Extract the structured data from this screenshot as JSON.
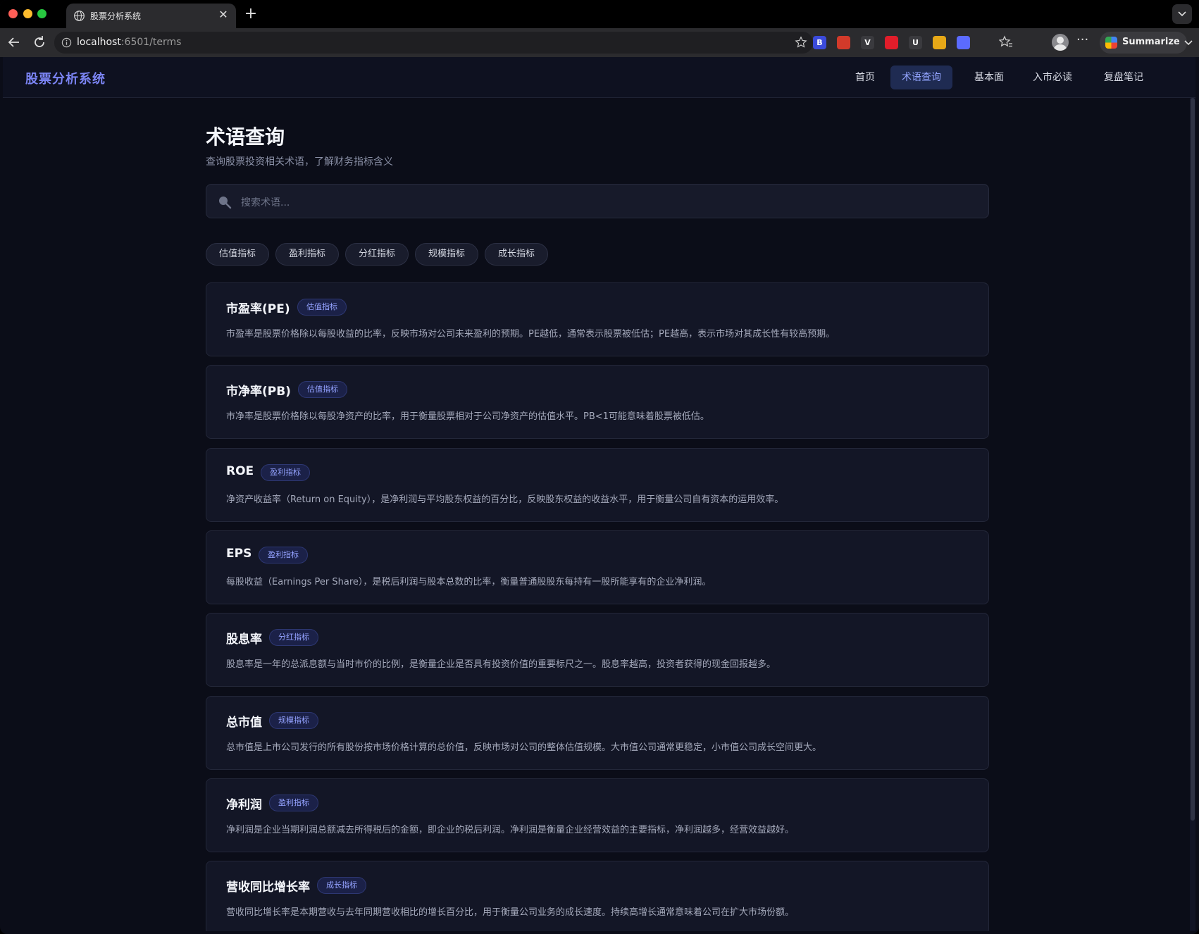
{
  "browser": {
    "tab_title": "股票分析系统",
    "url_host": "localhost",
    "url_path": ":6501/terms",
    "summarize_label": "Summarize",
    "extensions": [
      {
        "name": "b-extension-icon",
        "label": "B",
        "color": "#3b4bdb"
      },
      {
        "name": "red-extension-icon",
        "label": "",
        "color": "#d23a2a"
      },
      {
        "name": "v-extension-icon",
        "label": "V",
        "color": "#3a3a3e"
      },
      {
        "name": "shield-extension-icon",
        "label": "",
        "color": "#e11d2a"
      },
      {
        "name": "u-extension-icon",
        "label": "U",
        "color": "#3a3a3e"
      },
      {
        "name": "circle-extension-icon",
        "label": "",
        "color": "#e6a817"
      },
      {
        "name": "diamond-extension-icon",
        "label": "",
        "color": "#5b6bff"
      }
    ]
  },
  "app": {
    "brand": "股票分析系统",
    "nav": [
      {
        "label": "首页",
        "active": false
      },
      {
        "label": "术语查询",
        "active": true
      },
      {
        "label": "基本面",
        "active": false
      },
      {
        "label": "入市必读",
        "active": false
      },
      {
        "label": "复盘笔记",
        "active": false
      }
    ]
  },
  "main": {
    "title": "术语查询",
    "subtitle": "查询股票投资相关术语，了解财务指标含义",
    "search_placeholder": "搜索术语...",
    "filters": [
      "估值指标",
      "盈利指标",
      "分红指标",
      "规模指标",
      "成长指标"
    ],
    "terms": [
      {
        "term": "市盈率(PE)",
        "tag": "估值指标",
        "desc": "市盈率是股票价格除以每股收益的比率，反映市场对公司未来盈利的预期。PE越低，通常表示股票被低估；PE越高，表示市场对其成长性有较高预期。"
      },
      {
        "term": "市净率(PB)",
        "tag": "估值指标",
        "desc": "市净率是股票价格除以每股净资产的比率，用于衡量股票相对于公司净资产的估值水平。PB<1可能意味着股票被低估。"
      },
      {
        "term": "ROE",
        "tag": "盈利指标",
        "desc": "净资产收益率（Return on Equity），是净利润与平均股东权益的百分比，反映股东权益的收益水平，用于衡量公司自有资本的运用效率。"
      },
      {
        "term": "EPS",
        "tag": "盈利指标",
        "desc": "每股收益（Earnings Per Share），是税后利润与股本总数的比率，衡量普通股股东每持有一股所能享有的企业净利润。"
      },
      {
        "term": "股息率",
        "tag": "分红指标",
        "desc": "股息率是一年的总派息额与当时市价的比例，是衡量企业是否具有投资价值的重要标尺之一。股息率越高，投资者获得的现金回报越多。"
      },
      {
        "term": "总市值",
        "tag": "规模指标",
        "desc": "总市值是上市公司发行的所有股份按市场价格计算的总价值，反映市场对公司的整体估值规模。大市值公司通常更稳定，小市值公司成长空间更大。"
      },
      {
        "term": "净利润",
        "tag": "盈利指标",
        "desc": "净利润是企业当期利润总额减去所得税后的金额，即企业的税后利润。净利润是衡量企业经营效益的主要指标，净利润越多，经营效益越好。"
      },
      {
        "term": "营收同比增长率",
        "tag": "成长指标",
        "desc": "营收同比增长率是本期营收与去年同期营收相比的增长百分比，用于衡量公司业务的成长速度。持续高增长通常意味着公司在扩大市场份额。"
      }
    ]
  }
}
